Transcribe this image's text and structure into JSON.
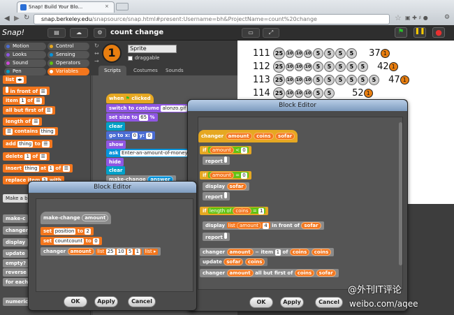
{
  "browser": {
    "tab_title": "Snap! Build Your Blo...",
    "tab_close": "×",
    "url_host": "snap.berkeley.edu",
    "url_path": "/snapsource/snap.html#present:Username=bh&ProjectName=count%20change"
  },
  "snap": {
    "logo": "Snap!",
    "project_title": "count change",
    "categories_left": [
      "Motion",
      "Looks",
      "Sound",
      "Pen"
    ],
    "categories_right": [
      "Control",
      "Sensing",
      "Operators",
      "Variables"
    ],
    "category_colors": {
      "Motion": "#4a6cd4",
      "Looks": "#8f56e3",
      "Sound": "#cf4ad9",
      "Pen": "#00a0c8",
      "Control": "#e6a822",
      "Sensing": "#0494dc",
      "Operators": "#62c213",
      "Variables": "#f3761d"
    },
    "selected_category": "Variables",
    "sprite_number": "1",
    "sprite_name": "Sprite",
    "draggable_label": "draggable",
    "script_tabs": [
      "Scripts",
      "Costumes",
      "Sounds"
    ]
  },
  "palette": {
    "list_block": "list",
    "in_front_of": "in front of",
    "item_of": [
      "item",
      "1",
      "of"
    ],
    "all_but_first_of": "all but first of",
    "length_of": "length of",
    "contains": "contains",
    "contains_val": "thing",
    "add": "add",
    "add_val": "thing",
    "add_to": "to",
    "delete": "delete",
    "delete_val": "1",
    "delete_of": "of",
    "insert": "insert",
    "insert_val": "thing",
    "insert_at": "at",
    "insert_pos": "1",
    "insert_of": "of",
    "replace": "replace item",
    "replace_with": "with",
    "make_block": "Make a blo",
    "lower_items": [
      "make-c",
      "changer",
      "display",
      "update",
      "empty?",
      "reverse",
      "for each",
      "numeric"
    ]
  },
  "script": {
    "when_clicked": [
      "when",
      "clicked"
    ],
    "switch_costume": "switch to costume",
    "costume_val": "alonzo.gif",
    "set_size": "set size to",
    "size_val": "65",
    "size_unit": "%",
    "clear1": "clear",
    "goto": [
      "go to x:",
      "0",
      "y:",
      "0"
    ],
    "show": "show",
    "ask": "ask",
    "ask_val": "Enter-an-amount-of-money-in-cents",
    "hide": "hide",
    "clear2": "clear",
    "make_change": "make-change",
    "answer": "answer"
  },
  "stage": {
    "rows": [
      {
        "num": "111",
        "coins": [
          "25",
          "10",
          "10",
          "10",
          "5",
          "5",
          "5",
          "5"
        ],
        "count": "37",
        "badge": "1"
      },
      {
        "num": "112",
        "coins": [
          "25",
          "10",
          "10",
          "10",
          "5",
          "5",
          "5",
          "5",
          "5"
        ],
        "count": "42",
        "badge": "1"
      },
      {
        "num": "113",
        "coins": [
          "25",
          "10",
          "10",
          "10",
          "5",
          "5",
          "5",
          "5",
          "5",
          "5"
        ],
        "count": "47",
        "badge": "1"
      },
      {
        "num": "114",
        "coins": [
          "25",
          "10",
          "10",
          "10",
          "5",
          "5"
        ],
        "count": "52",
        "badge": "1"
      }
    ]
  },
  "dialog_small": {
    "title": "Block Editor",
    "hat": "make-change",
    "hat_param": "amount",
    "set1": [
      "set",
      "position",
      "to",
      "2"
    ],
    "set2": [
      "set",
      "countcount",
      "to",
      "0"
    ],
    "changer": "changer",
    "changer_arg": "amount",
    "list_label": "list",
    "list_vals": [
      "25",
      "10",
      "5",
      "1"
    ],
    "ok": "OK",
    "apply": "Apply",
    "cancel": "Cancel"
  },
  "dialog_large": {
    "title": "Block Editor",
    "hat": "changer",
    "hat_params": [
      "amount",
      "coins",
      "sofar"
    ],
    "if_label": "if",
    "amt": "amount",
    "lt": "<",
    "zero": "0",
    "eq": "=",
    "report": "report",
    "display": "display",
    "sofar": "sofar",
    "length_of": "length of",
    "coins": "coins",
    "one": "1",
    "list": "list",
    "four": "4",
    "in_front_of": "in front of",
    "changer": "changer",
    "minus": "−",
    "item": "item",
    "of": "of",
    "update": "update",
    "all_but_first": "all but first of",
    "ok": "OK",
    "apply": "Apply",
    "cancel": "Cancel"
  },
  "watermark": {
    "line1": "@外刊IT评论",
    "line2": "weibo.com/aqee"
  }
}
